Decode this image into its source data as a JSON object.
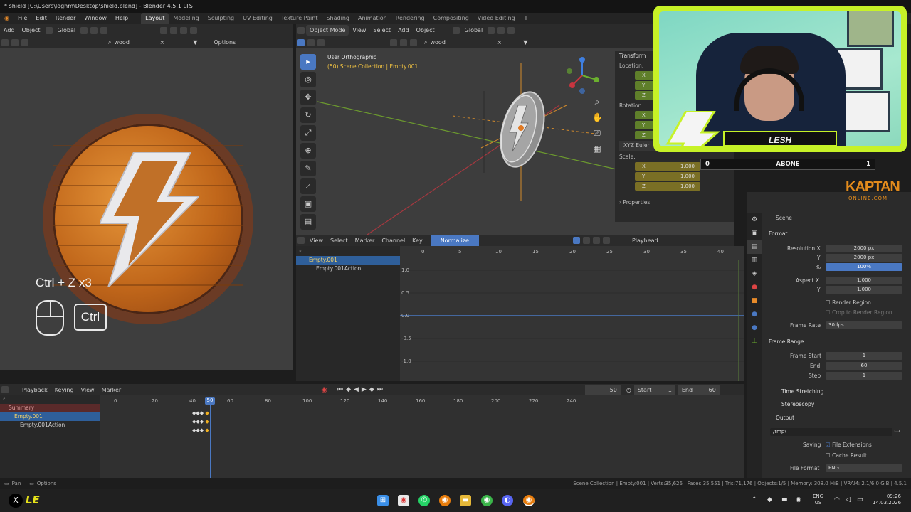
{
  "window": {
    "title": "* shield [C:\\Users\\loghm\\Desktop\\shield.blend] - Blender 4.5.1 LTS"
  },
  "menu": {
    "items": [
      "File",
      "Edit",
      "Render",
      "Window",
      "Help"
    ],
    "workspaces": [
      "Layout",
      "Modeling",
      "Sculpting",
      "UV Editing",
      "Texture Paint",
      "Shading",
      "Animation",
      "Rendering",
      "Compositing",
      "Video Editing"
    ]
  },
  "image_editor": {
    "header_row1": [
      "Add",
      "Object",
      "Global"
    ],
    "search_value": "wood",
    "options_label": "Options",
    "shortcut_text": "Ctrl + Z x3",
    "ctrl_key": "Ctrl"
  },
  "viewport": {
    "mode": "Object Mode",
    "menus": [
      "View",
      "Select",
      "Add",
      "Object"
    ],
    "orientation": "Global",
    "search_value": "wood",
    "view_name": "User Orthographic",
    "collection_info": "(50) Scene Collection | Empty.001",
    "n_panel": {
      "title": "Transform",
      "location_label": "Location:",
      "rotation_label": "Rotation:",
      "rotation_mode": "XYZ Euler",
      "scale_label": "Scale:",
      "axes": [
        "X",
        "Y",
        "Z"
      ],
      "scale_values": [
        "1.000",
        "1.000",
        "1.000"
      ],
      "properties_label": "Properties"
    }
  },
  "graph_editor": {
    "menus": [
      "View",
      "Select",
      "Marker",
      "Channel",
      "Key"
    ],
    "normalize_label": "Normalize",
    "playhead_label": "Playhead",
    "channels": [
      "Empty.001",
      "Empty.001Action"
    ],
    "x_ticks": [
      "0",
      "5",
      "10",
      "15",
      "20",
      "25",
      "30",
      "35",
      "40"
    ],
    "y_ticks": [
      "1.0",
      "0.5",
      "0.0",
      "-0.5",
      "-1.0"
    ]
  },
  "timeline": {
    "menus": [
      "Playback",
      "Keying",
      "View",
      "Marker"
    ],
    "current_frame": "50",
    "start_label": "Start",
    "start_value": "1",
    "end_label": "End",
    "end_value": "60",
    "ticks": [
      "0",
      "20",
      "40",
      "60",
      "80",
      "100",
      "120",
      "140",
      "160",
      "180",
      "200",
      "220",
      "240"
    ],
    "channels": [
      "Summary",
      "Empty.001",
      "Empty.001Action"
    ]
  },
  "properties": {
    "scene_label": "Scene",
    "format_label": "Format",
    "resolution_x_label": "Resolution X",
    "resolution_x": "2000 px",
    "resolution_y_label": "Y",
    "resolution_y": "2000 px",
    "percent_label": "%",
    "percent": "100%",
    "aspect_x_label": "Aspect X",
    "aspect_x": "1.000",
    "aspect_y_label": "Y",
    "aspect_y": "1.000",
    "render_region_label": "Render Region",
    "crop_label": "Crop to Render Region",
    "frame_rate_label": "Frame Rate",
    "frame_rate": "30 fps",
    "frame_range_label": "Frame Range",
    "frame_start_label": "Frame Start",
    "frame_start": "1",
    "end_label": "End",
    "end": "60",
    "step_label": "Step",
    "step": "1",
    "time_stretching_label": "Time Stretching",
    "stereoscopy_label": "Stereoscopy",
    "output_label": "Output",
    "output_path": "/tmp\\",
    "saving_label": "Saving",
    "file_extensions_label": "File Extensions",
    "cache_result_label": "Cache Result",
    "file_format_label": "File Format",
    "file_format": "PNG"
  },
  "overlay": {
    "streamer_name": "LESH",
    "abone_label": "ABONE",
    "abone_left": "0",
    "abone_right": "1",
    "brand_main": "KAPTAN",
    "brand_sub": "ONLINE.COM",
    "bottom_logo": "LE"
  },
  "statusbar": {
    "left_items": [
      "Pan",
      "Options"
    ],
    "info": "Scene Collection | Empty.001 | Verts:35,626 | Faces:35,551 | Tris:71,176 | Objects:1/5 | Memory: 308.0 MiB | VRAM: 2.1/6.0 GiB | 4.5.1"
  },
  "taskbar": {
    "lang": "ENG",
    "region": "US",
    "time": "09:26",
    "date": "14.03.2026"
  },
  "colors": {
    "accent_blue": "#4a78c2",
    "selected_text": "#f5d36a",
    "overlay_lime": "#c7f227",
    "brand_orange": "#e38b1c"
  }
}
